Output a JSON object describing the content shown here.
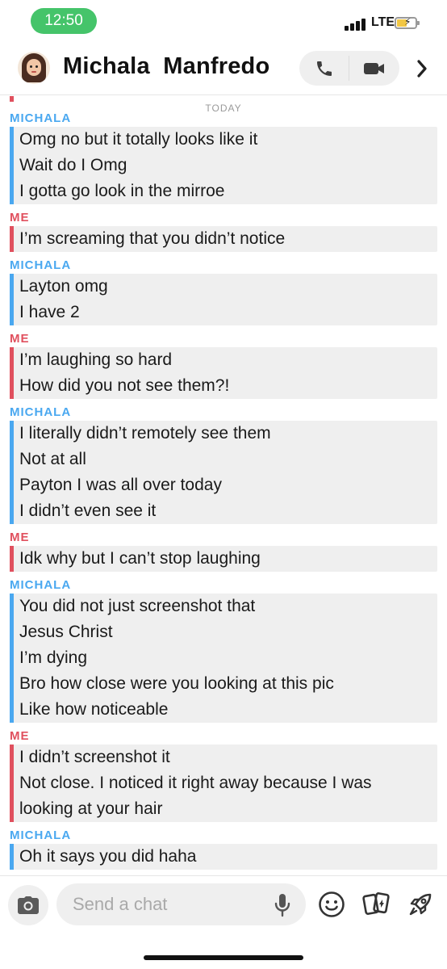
{
  "status_bar": {
    "time": "12:50",
    "network": "LTE"
  },
  "header": {
    "contact_name": "Michala  Manfredo",
    "icons": {
      "avatar": "bitmoji-avatar",
      "call": "phone-icon",
      "video": "video-camera-icon",
      "more": "chevron-right-icon"
    }
  },
  "chat": {
    "date_separator": "TODAY",
    "groups": [
      {
        "sender": "MICHALA",
        "from": "them",
        "lines": [
          "Omg no but it totally looks like it",
          "Wait do I Omg",
          "I gotta go look in the mirroe"
        ]
      },
      {
        "sender": "ME",
        "from": "me",
        "lines": [
          "I’m screaming that you didn’t notice"
        ]
      },
      {
        "sender": "MICHALA",
        "from": "them",
        "lines": [
          "Layton omg",
          "I have 2"
        ]
      },
      {
        "sender": "ME",
        "from": "me",
        "lines": [
          "I’m laughing so hard",
          "How did you not see them?!"
        ]
      },
      {
        "sender": "MICHALA",
        "from": "them",
        "lines": [
          "I literally didn’t remotely see them",
          "Not at all",
          "Payton I was all over today",
          "I didn’t even see it"
        ]
      },
      {
        "sender": "ME",
        "from": "me",
        "lines": [
          "Idk why but I can’t stop laughing"
        ]
      },
      {
        "sender": "MICHALA",
        "from": "them",
        "lines": [
          "You did not just screenshot that",
          "Jesus Christ",
          "I’m dying",
          "Bro how close were you looking at this pic",
          "Like how noticeable"
        ]
      },
      {
        "sender": "ME",
        "from": "me",
        "lines": [
          "I didn’t screenshot it",
          "Not close. I noticed it right away because I was",
          "looking at your hair"
        ]
      },
      {
        "sender": "MICHALA",
        "from": "them",
        "lines": [
          "Oh it says you did haha"
        ]
      }
    ]
  },
  "composer": {
    "placeholder": "Send a chat",
    "value": "",
    "icons": [
      "camera-icon",
      "microphone-icon",
      "smiley-icon",
      "memories-cards-icon",
      "rocket-icon"
    ]
  },
  "colors": {
    "them": "#4aa8f0",
    "me": "#e0505e",
    "bubble": "#efefef",
    "status_pill": "#45c46a"
  }
}
